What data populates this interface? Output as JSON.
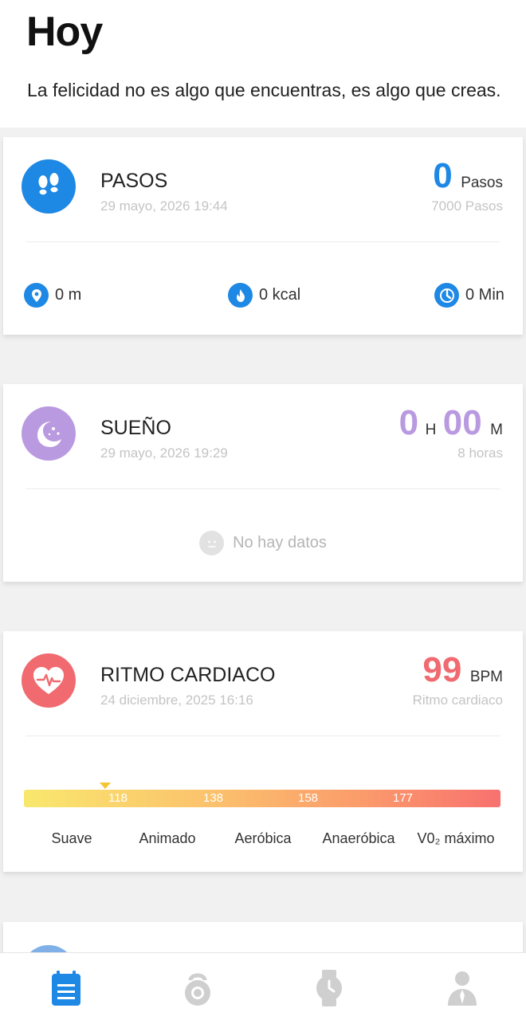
{
  "header": {
    "title": "Hoy",
    "quote": "La felicidad no es algo que encuentras, es algo que creas."
  },
  "steps": {
    "icon": "footprints-icon",
    "title": "PASOS",
    "date": "29 mayo, 2026 19:44",
    "value": "0",
    "unit": "Pasos",
    "goal": "7000 Pasos",
    "color": "#1e88e5",
    "stats": [
      {
        "icon": "location-pin-icon",
        "label": "0 m"
      },
      {
        "icon": "flame-icon",
        "label": "0 kcal"
      },
      {
        "icon": "clock-icon",
        "label": "0 Min"
      }
    ]
  },
  "sleep": {
    "icon": "moon-stars-icon",
    "title": "SUEÑO",
    "date": "29 mayo, 2026 19:29",
    "hours": "0",
    "hours_unit": "H",
    "minutes": "00",
    "minutes_unit": "M",
    "goal": "8 horas",
    "empty_text": "No hay datos",
    "color": "#b99ae0"
  },
  "heart": {
    "icon": "heart-pulse-icon",
    "title": "RITMO CARDIACO",
    "date": "24 diciembre, 2025 16:16",
    "value": "99",
    "unit": "BPM",
    "sub": "Ritmo cardiaco",
    "color": "#f06a6f",
    "thresholds": [
      "118",
      "138",
      "158",
      "177"
    ],
    "zones": [
      "Suave",
      "Animado",
      "Aeróbica",
      "Anaeróbica",
      "V0₂ máximo"
    ],
    "current_fraction": 0.17
  },
  "nav": {
    "items": [
      {
        "icon": "clipboard-list-icon",
        "active": true
      },
      {
        "icon": "kettlebell-icon",
        "active": false
      },
      {
        "icon": "watch-icon",
        "active": false
      },
      {
        "icon": "person-icon",
        "active": false
      }
    ],
    "active_color": "#1e88e5",
    "inactive_color": "#cfcfcf"
  }
}
